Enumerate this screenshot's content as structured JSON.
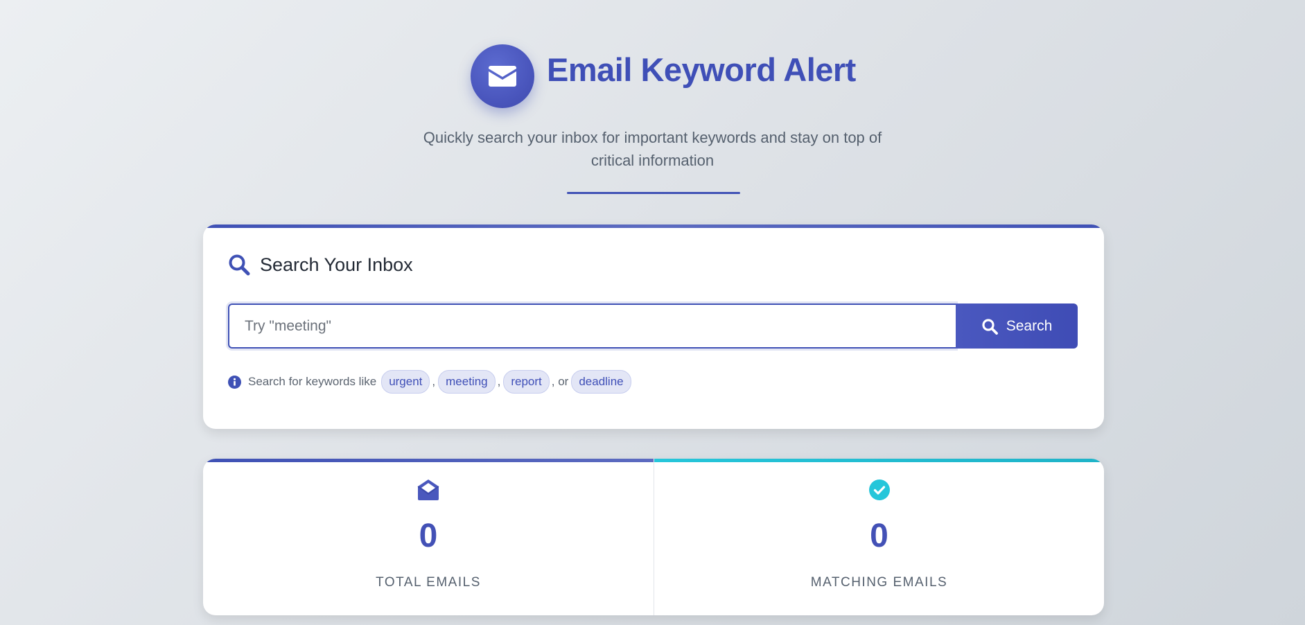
{
  "header": {
    "title": "Email Keyword Alert",
    "subtitle": "Quickly search your inbox for important keywords and stay on top of critical information",
    "logo_icon": "envelope-icon"
  },
  "search_card": {
    "heading": "Search Your Inbox",
    "heading_icon": "search-icon",
    "input": {
      "value": "",
      "placeholder": "Try \"meeting\""
    },
    "button_label": "Search",
    "hint": {
      "icon": "info-icon",
      "text": "Search for keywords like",
      "keywords": [
        "urgent",
        "meeting",
        "report",
        "deadline"
      ],
      "separators": [
        ",",
        ",",
        ", or"
      ]
    }
  },
  "stats": [
    {
      "icon": "envelope-open-icon",
      "value": "0",
      "label": "TOTAL EMAILS",
      "accent": "#3f51b5"
    },
    {
      "icon": "check-circle-icon",
      "value": "0",
      "label": "MATCHING EMAILS",
      "accent": "#26c6da"
    }
  ],
  "colors": {
    "primary": "#3f51b5",
    "secondary": "#26c6da",
    "chip_bg": "#e3e6f6"
  }
}
